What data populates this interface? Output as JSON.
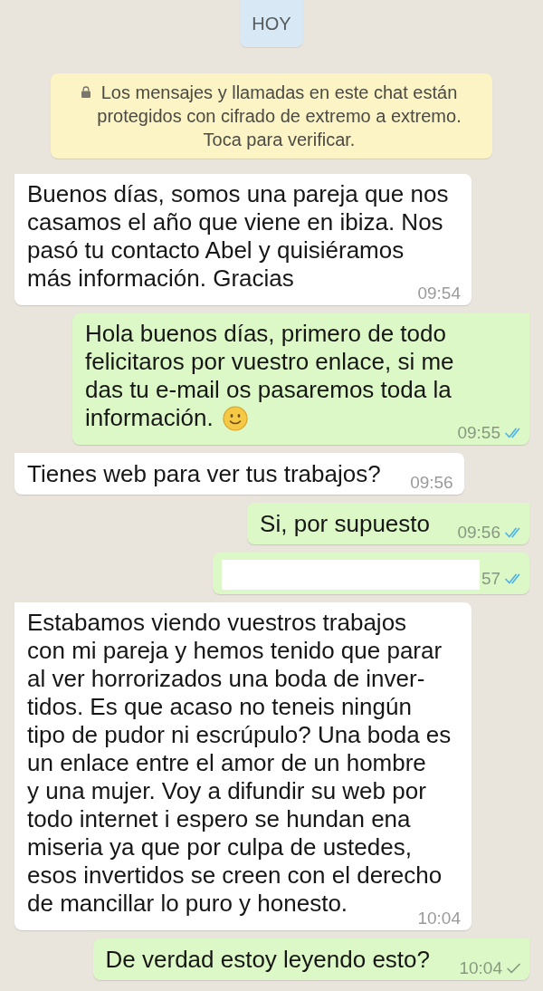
{
  "date_chip": {
    "label": "HOY"
  },
  "encryption_notice": {
    "text": "Los mensajes y llamadas en este chat están\nprotegidos con cifrado de extremo a extremo.\nToca para verificar."
  },
  "messages": [
    {
      "kind": "text",
      "outgoing": false,
      "tail": true,
      "text": "Buenos días, somos una pareja que nos\ncasamos el año que viene en ibiza. Nos\npasó tu contacto Abel y quisiéramos\nmás información. Gracias",
      "emoji": false,
      "time": "09:54"
    },
    {
      "kind": "text",
      "outgoing": true,
      "tail": true,
      "text": "Hola buenos días, primero de todo\nfelicitaros por vuestro enlace, si me\ndas tu e-mail os pasaremos toda la\ninformación.",
      "emoji": true,
      "time": "09:55",
      "delivered": true,
      "read": true
    },
    {
      "kind": "text",
      "outgoing": false,
      "tail": true,
      "text": "Tienes web para ver tus trabajos?",
      "emoji": false,
      "time": "09:56"
    },
    {
      "kind": "text",
      "outgoing": true,
      "tail": true,
      "text": "Si, por supuesto",
      "emoji": false,
      "time": "09:56",
      "delivered": true,
      "read": true
    },
    {
      "kind": "redacted",
      "outgoing": true,
      "tail": false,
      "time": "57",
      "delivered": true,
      "read": true
    },
    {
      "kind": "text",
      "outgoing": false,
      "tail": true,
      "text": "Estabamos viendo vuestros trabajos\ncon mi pareja y hemos tenido que parar\nal ver horrorizados una boda de inver-\ntidos. Es que acaso no teneis ningún\ntipo de pudor ni escrúpulo? Una boda es\nun enlace entre el amor de un hombre\ny una mujer. Voy a difundir su web por\ntodo internet i espero se hundan ena\nmiseria ya que por culpa de ustedes,\nesos invertidos se creen con el derecho\nde mancillar lo puro y honesto.",
      "emoji": false,
      "time": "10:04"
    },
    {
      "kind": "text",
      "outgoing": true,
      "tail": true,
      "text": "De verdad estoy leyendo esto?",
      "emoji": false,
      "time": "10:04",
      "delivered": false,
      "read": false
    }
  ]
}
